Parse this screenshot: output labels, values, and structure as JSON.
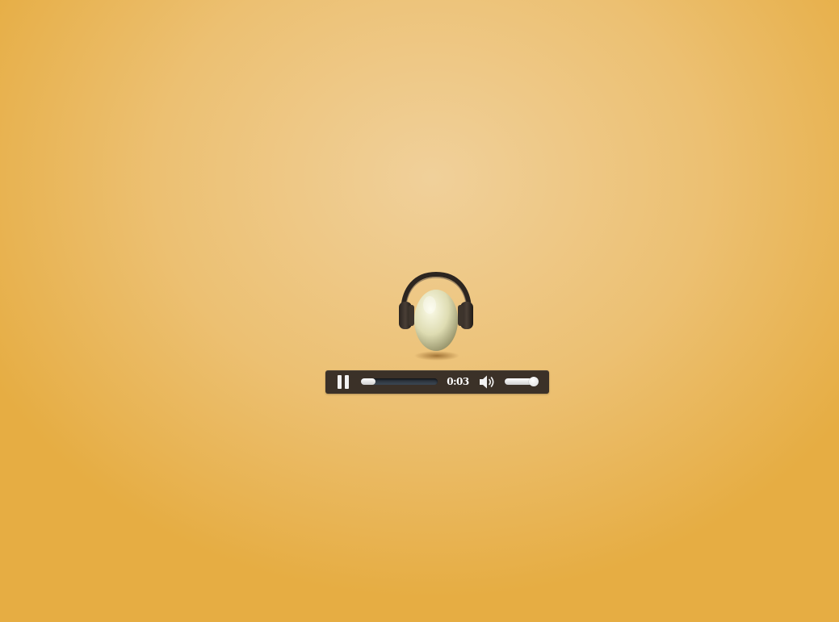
{
  "artwork": {
    "icon": "egg-with-headphones-icon"
  },
  "player": {
    "state": "playing",
    "pause_icon": "pause-icon",
    "current_time": "0:03",
    "progress": 0.12,
    "volume_icon": "speaker-volume-icon",
    "volume": 0.85
  }
}
